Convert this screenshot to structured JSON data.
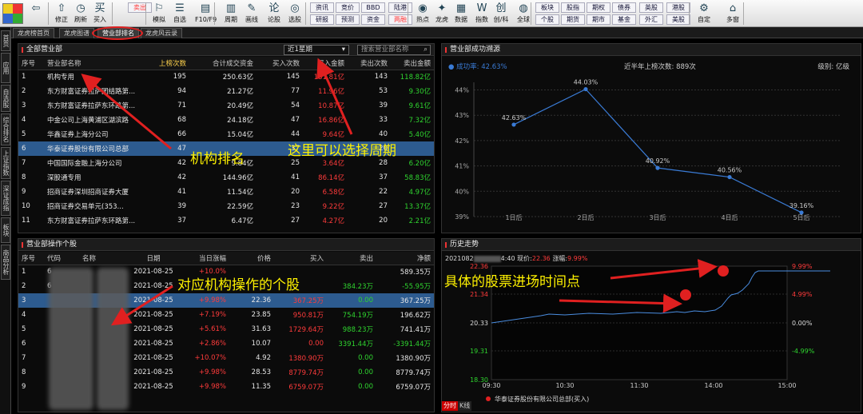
{
  "toolbar": {
    "buttons": [
      {
        "label": "修正",
        "icon": "⇧"
      },
      {
        "label": "刷新",
        "icon": "◷"
      },
      {
        "label": "买入",
        "icon": "买"
      },
      {
        "label": "模拟",
        "icon": "⚐"
      },
      {
        "label": "自选",
        "icon": "☰"
      },
      {
        "label": "F10/F9",
        "icon": "▤"
      },
      {
        "label": "周期",
        "icon": "▥"
      },
      {
        "label": "画线",
        "icon": "✎"
      },
      {
        "label": "论股",
        "icon": "论"
      },
      {
        "label": "选股",
        "icon": "◎"
      },
      {
        "label": "热点",
        "icon": "◉"
      },
      {
        "label": "龙虎",
        "icon": "✦"
      },
      {
        "label": "数据",
        "icon": "▦"
      },
      {
        "label": "指数",
        "icon": "W"
      },
      {
        "label": "创/科",
        "icon": "创"
      },
      {
        "label": "全球",
        "icon": "◍"
      },
      {
        "label": "自定",
        "icon": "⚙"
      },
      {
        "label": "多窗",
        "icon": "⌂"
      }
    ],
    "small_buttons": [
      "卖出",
      "资讯",
      "竞价",
      "BBD",
      "陆港",
      "研报",
      "预测",
      "资金",
      "两融",
      "板块",
      "股指",
      "期权",
      "债券",
      "英股",
      "港股",
      "个股",
      "期货",
      "期市",
      "基金",
      "外汇",
      "美股"
    ]
  },
  "tabs": [
    "龙虎榜首页",
    "龙虎图谱",
    "营业部排名",
    "龙虎风云录"
  ],
  "sidebar": [
    "首页",
    "应用",
    "自选股",
    "综合排名",
    "上证指数",
    "深证成指",
    "板块",
    "商品分析"
  ],
  "rank_panel": {
    "title": "全部营业部",
    "period": "近1星期",
    "search_placeholder": "搜索营业部名称",
    "columns": [
      "序号",
      "营业部名称",
      "上榜次数",
      "合计成交资金",
      "买入次数",
      "买入金额",
      "卖出次数",
      "卖出金额"
    ],
    "rows": [
      [
        "1",
        "机构专用",
        "195",
        "250.63亿",
        "145",
        "131.81亿",
        "143",
        "118.82亿"
      ],
      [
        "2",
        "东方财富证券拉萨团结路第...",
        "94",
        "21.27亿",
        "77",
        "11.96亿",
        "53",
        "9.30亿"
      ],
      [
        "3",
        "东方财富证券拉萨东环路第...",
        "71",
        "20.49亿",
        "54",
        "10.87亿",
        "39",
        "9.61亿"
      ],
      [
        "4",
        "中金公司上海黄浦区湖滨路",
        "68",
        "24.18亿",
        "47",
        "16.86亿",
        "33",
        "7.32亿"
      ],
      [
        "5",
        "华鑫证券上海分公司",
        "66",
        "15.04亿",
        "44",
        "9.64亿",
        "40",
        "5.40亿"
      ],
      [
        "6",
        "华泰证券股份有限公司总部",
        "47",
        "",
        "37",
        "",
        "20",
        ""
      ],
      [
        "7",
        "中国国际金融上海分公司",
        "42",
        "9.84亿",
        "25",
        "3.64亿",
        "28",
        "6.20亿"
      ],
      [
        "8",
        "深股通专用",
        "42",
        "144.96亿",
        "41",
        "86.14亿",
        "37",
        "58.83亿"
      ],
      [
        "9",
        "招商证券深圳招商证券大厦",
        "41",
        "11.54亿",
        "20",
        "6.58亿",
        "22",
        "4.97亿"
      ],
      [
        "10",
        "招商证券交易单元(353...",
        "39",
        "22.59亿",
        "23",
        "9.22亿",
        "27",
        "13.37亿"
      ],
      [
        "11",
        "东方财富证券拉萨东环路第...",
        "37",
        "6.47亿",
        "27",
        "4.27亿",
        "20",
        "2.21亿"
      ]
    ]
  },
  "success_panel": {
    "title": "营业部成功溯源",
    "legend": "成功率: 42.63%",
    "count_label": "近半年上榜次数: 889次",
    "unit_label": "级别: 亿级"
  },
  "chart_data": {
    "type": "line",
    "categories": [
      "1日后",
      "2日后",
      "3日后",
      "4日后",
      "5日后"
    ],
    "values": [
      42.63,
      44.03,
      40.92,
      40.56,
      39.16
    ],
    "data_labels": [
      "42.63%",
      "44.03%",
      "40.92%",
      "40.56%",
      "39.16%"
    ],
    "yticks": [
      "44%",
      "43%",
      "42%",
      "41%",
      "40%",
      "39%"
    ],
    "ylim": [
      39,
      44.3
    ],
    "grid": true
  },
  "ops_panel": {
    "title": "营业部操作个股",
    "columns": [
      "序号",
      "代码",
      "名称",
      "日期",
      "当日涨幅",
      "价格",
      "买入",
      "卖出",
      "净额"
    ],
    "rows": [
      [
        "1",
        "6",
        "",
        "2021-08-25",
        "+10.0%",
        "",
        "",
        "",
        "589.35万"
      ],
      [
        "2",
        "6",
        "",
        "2021-08-25",
        "",
        "",
        "",
        "384.23万",
        "-55.95万"
      ],
      [
        "3",
        "",
        "",
        "2021-08-25",
        "+9.98%",
        "22.36",
        "367.25万",
        "0.00",
        "367.25万"
      ],
      [
        "4",
        "",
        "",
        "2021-08-25",
        "+7.19%",
        "23.85",
        "950.81万",
        "754.19万",
        "196.62万"
      ],
      [
        "5",
        "",
        "",
        "2021-08-25",
        "+5.61%",
        "31.63",
        "1729.64万",
        "988.23万",
        "741.41万"
      ],
      [
        "6",
        "",
        "",
        "2021-08-25",
        "+2.86%",
        "10.07",
        "0.00",
        "3391.44万",
        "-3391.44万"
      ],
      [
        "7",
        "",
        "",
        "2021-08-25",
        "+10.07%",
        "4.92",
        "1380.90万",
        "0.00",
        "1380.90万"
      ],
      [
        "8",
        "",
        "",
        "2021-08-25",
        "+9.98%",
        "28.53",
        "8779.74万",
        "0.00",
        "8779.74万"
      ],
      [
        "9",
        "",
        "",
        "2021-08-25",
        "+9.98%",
        "11.35",
        "6759.07万",
        "0.00",
        "6759.07万"
      ]
    ]
  },
  "history_panel": {
    "title": "历史走势",
    "date_prefix": "2021082",
    "time_suffix": "4:40",
    "price_label": "现价:",
    "price_value": "22.36",
    "change_label": "涨幅:",
    "change_value": "9.99%",
    "left_axis": [
      "22.36",
      "21.34",
      "20.33",
      "19.31",
      "18.30"
    ],
    "right_axis": [
      "9.99%",
      "4.99%",
      "0.00%",
      "-4.99%"
    ],
    "time_axis": [
      "09:30",
      "10:30",
      "11:30",
      "14:00",
      "15:00"
    ],
    "legend": "华泰证券股份有限公司总部(买入)",
    "bottom_tabs": [
      "分时",
      "K线"
    ]
  },
  "annotations": {
    "ranking": "机构排名",
    "period": "这里可以选择周期",
    "stocks": "对应机构操作的个股",
    "timing": "具体的股票进场时间点"
  },
  "colors": {
    "up": "#ff3b3b",
    "down": "#2fd52f",
    "selected": "#2d5b8f",
    "line": "#3a7bd5",
    "annotation": "#fff200"
  }
}
